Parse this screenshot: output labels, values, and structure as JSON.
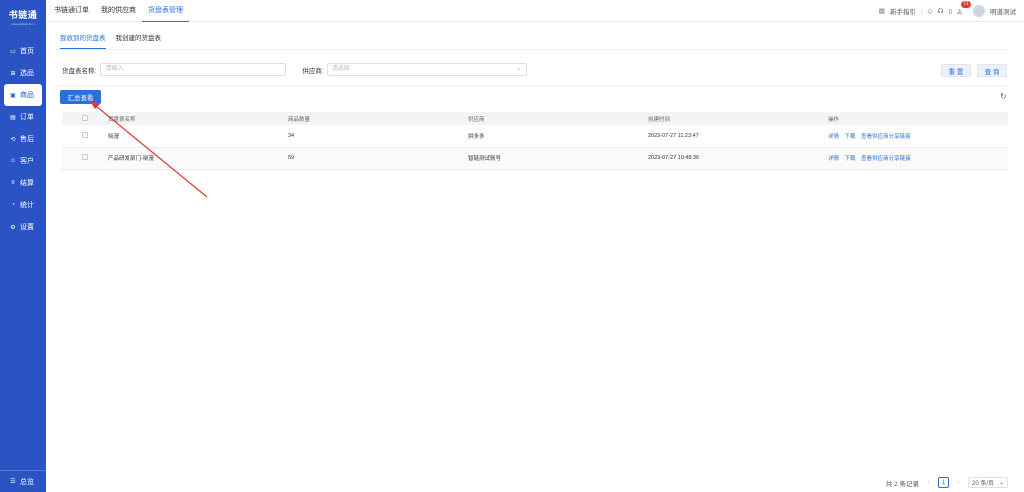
{
  "brand": {
    "title": "书链通",
    "subtitle": "www.shulian.com"
  },
  "sidebar": {
    "items": [
      {
        "icon": "monitor-icon",
        "glyph": "▭",
        "label": "首页"
      },
      {
        "icon": "product-select-icon",
        "glyph": "⊞",
        "label": "选品"
      },
      {
        "icon": "goods-icon",
        "glyph": "▣",
        "label": "商品"
      },
      {
        "icon": "order-icon",
        "glyph": "▤",
        "label": "订单"
      },
      {
        "icon": "after-sale-icon",
        "glyph": "⟲",
        "label": "售后"
      },
      {
        "icon": "customer-icon",
        "glyph": "☺",
        "label": "客户"
      },
      {
        "icon": "settlement-icon",
        "glyph": "¤",
        "label": "结算"
      },
      {
        "icon": "stats-icon",
        "glyph": "◔",
        "label": "统计"
      },
      {
        "icon": "settings-icon",
        "glyph": "⚙",
        "label": "设置"
      }
    ],
    "bottom": {
      "glyph": "☰",
      "label": "总览"
    }
  },
  "topbar": {
    "tabs": [
      "书链通订单",
      "我的供应商",
      "货盘表管理"
    ],
    "guide": "新手指引",
    "badge": "71",
    "user": "明道测试"
  },
  "subtabs": [
    "我收到的货盘表",
    "我创建的货盘表"
  ],
  "filters": {
    "name_label": "货盘表名称:",
    "name_placeholder": "请输入",
    "supplier_label": "供应商:",
    "supplier_placeholder": "请选择",
    "reset": "重 置",
    "query": "查 询"
  },
  "summary_button": "汇总查看",
  "table": {
    "headers": [
      "货盘表名称",
      "商品数量",
      "供应商",
      "创建时间",
      "操作"
    ],
    "rows": [
      {
        "name": "晓漫",
        "count": "34",
        "supplier": "拼多多",
        "time": "2023-07-27 11:23:47"
      },
      {
        "name": "产品研发部门-晓漫",
        "count": "59",
        "supplier": "智链测试账号",
        "time": "2023-07-27 10:48:36"
      }
    ],
    "actions": [
      "详情",
      "下载",
      "查看供应商分享链接"
    ]
  },
  "pagination": {
    "total": "共 2 条记录",
    "current": "1",
    "page_size": "20 条/页"
  },
  "colors": {
    "sidebar": "#2a54c4",
    "accent": "#2a6fdb",
    "annotation_arrow": "#e53935"
  }
}
